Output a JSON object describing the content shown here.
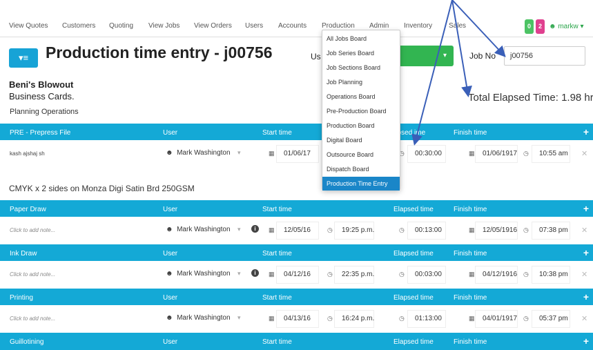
{
  "nav": {
    "items": [
      "View Quotes",
      "Customers",
      "Quoting",
      "View Jobs",
      "View Orders",
      "Users",
      "Accounts",
      "Production",
      "Admin",
      "Inventory",
      "Sales"
    ],
    "badge_green": "0",
    "badge_pink": "2",
    "user": "markw",
    "colors": {
      "green": "#4cc364",
      "pink": "#e0408f"
    }
  },
  "header": {
    "title": "Production time entry - j00756",
    "user_label": "Us",
    "job_no_label": "Job No",
    "job_no_value": "j00756"
  },
  "job": {
    "customer": "Beni's Blowout",
    "product": "Business Cards.",
    "planning": "Planning Operations",
    "total_elapsed": "Total Elapsed Time: 1.98 hrs",
    "paper_desc": "CMYK x 2 sides on Monza Digi Satin Brd 250GSM"
  },
  "columns": {
    "user": "User",
    "start": "Start time",
    "elapsed": "Elapsed time",
    "finish": "Finish time"
  },
  "sections": [
    {
      "name": "PRE - Prepress File",
      "note": "kash ajshaj sh",
      "user": "Mark Washington",
      "start_date": "01/06/17",
      "start_time": "",
      "elapsed": "00:30:00",
      "finish_date": "01/06/1917",
      "finish_time": "10:55 am",
      "elapsed_header": "apsed ime"
    },
    {
      "name": "Paper Draw",
      "note": "Click to add note...",
      "user": "Mark Washington",
      "start_date": "12/05/16",
      "start_time": "19:25 p.m.",
      "elapsed": "00:13:00",
      "finish_date": "12/05/1916",
      "finish_time": "07:38 pm"
    },
    {
      "name": "Ink Draw",
      "note": "Click to add note...",
      "user": "Mark Washington",
      "start_date": "04/12/16",
      "start_time": "22:35 p.m.",
      "elapsed": "00:03:00",
      "finish_date": "04/12/1916",
      "finish_time": "10:38 pm"
    },
    {
      "name": "Printing",
      "note": "Click to add note...",
      "user": "Mark Washington",
      "start_date": "04/13/16",
      "start_time": "16:24 p.m.",
      "elapsed": "01:13:00",
      "finish_date": "04/01/1917",
      "finish_time": "05:37 pm"
    },
    {
      "name": "Guillotining"
    }
  ],
  "dropdown": [
    "All Jobs Board",
    "Job Series Board",
    "Job Sections Board",
    "Job Planning",
    "Operations Board",
    "Pre-Production Board",
    "Production Board",
    "Digital Board",
    "Outsource Board",
    "Dispatch Board",
    "Production Time Entry"
  ],
  "icons": {
    "user": "user-icon",
    "calendar": "calendar-icon",
    "clock": "clock-icon",
    "info": "info-icon",
    "plus": "plus-icon",
    "close": "close-icon"
  }
}
